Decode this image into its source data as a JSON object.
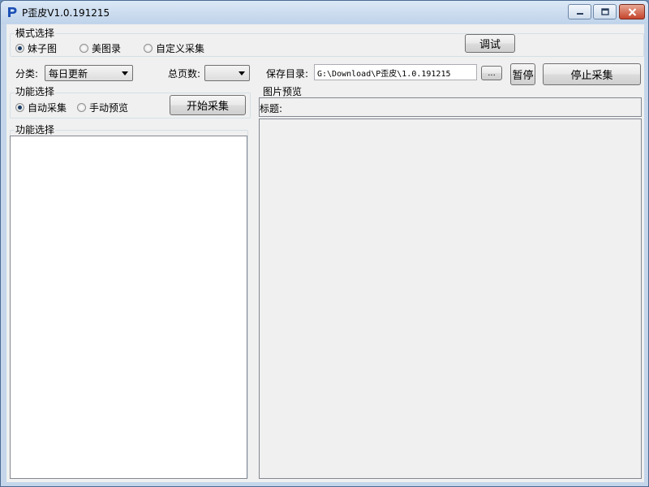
{
  "window": {
    "title": "P歪皮V1.0.191215"
  },
  "mode_group": {
    "legend": "模式选择",
    "options": [
      {
        "label": "妹子图",
        "checked": true
      },
      {
        "label": "美图录",
        "checked": false
      },
      {
        "label": "自定义采集",
        "checked": false
      }
    ],
    "debug_label": "调试"
  },
  "settings_row": {
    "category_label": "分类:",
    "category_value": "每日更新",
    "total_pages_label": "总页数:",
    "total_pages_value": "",
    "save_dir_label": "保存目录:",
    "save_dir_value": "G:\\Download\\P歪皮\\1.0.191215",
    "browse_label": "...",
    "pause_label": "暂停",
    "stop_label": "停止采集"
  },
  "function_group": {
    "legend": "功能选择",
    "options": [
      {
        "label": "自动采集",
        "checked": true
      },
      {
        "label": "手动预览",
        "checked": false
      }
    ],
    "start_label": "开始采集"
  },
  "list_group": {
    "legend": "功能选择"
  },
  "preview_group": {
    "legend": "图片预览",
    "title_label": "标题:"
  }
}
